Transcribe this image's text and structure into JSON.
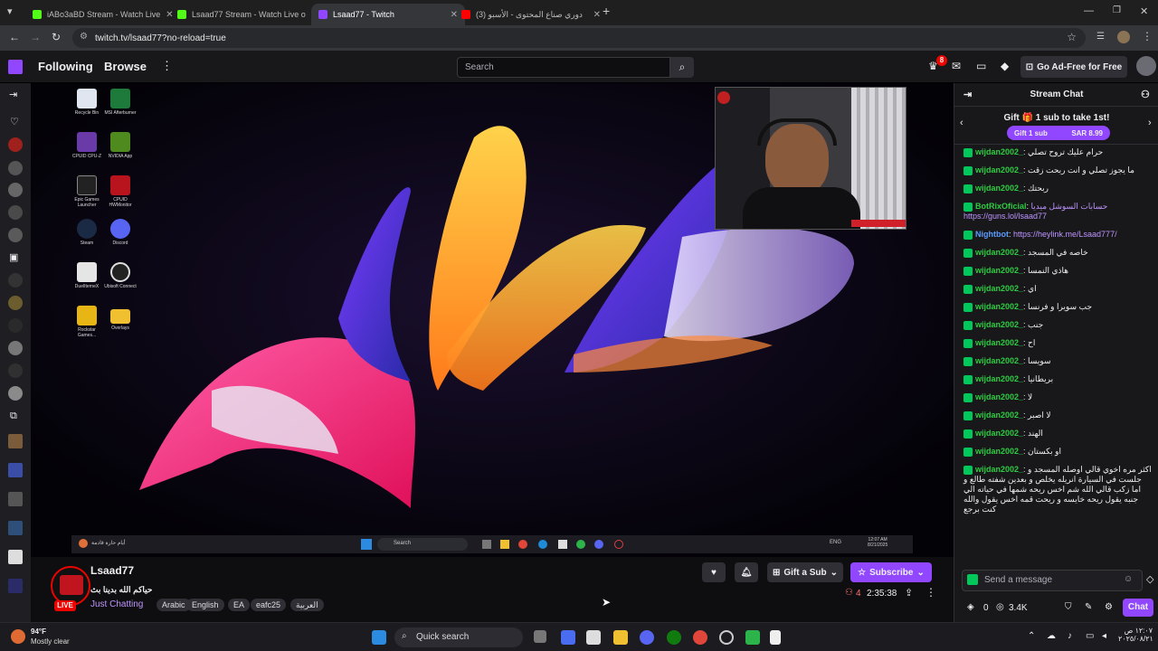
{
  "browser": {
    "tabs": [
      {
        "title": "iABo3aBD Stream - Watch Live",
        "active": false
      },
      {
        "title": "Lsaad77 Stream - Watch Live o",
        "active": false
      },
      {
        "title": "Lsaad77 - Twitch",
        "active": true
      },
      {
        "title": "(3) دوري صناع المحتوى - الأسبو",
        "active": false
      }
    ],
    "url": "twitch.tv/lsaad77?no-reload=true"
  },
  "nav": {
    "following": "Following",
    "browse": "Browse",
    "search_placeholder": "Search",
    "notification_count": "8",
    "ad_free": "Go Ad-Free for Free"
  },
  "stream": {
    "desktop_icons": [
      {
        "label": "Recycle Bin",
        "color": "#dfe6f0"
      },
      {
        "label": "MSI Afterburner",
        "color": "#1e7a3a"
      },
      {
        "label": "CPUID CPU-Z",
        "color": "#6a3aa8"
      },
      {
        "label": "NVIDIA App",
        "color": "#4f8a1e"
      },
      {
        "label": "Epic Games Launcher",
        "color": "#222"
      },
      {
        "label": "CPUID HWMonitor",
        "color": "#b8141e"
      },
      {
        "label": "Steam",
        "color": "#1b2a44"
      },
      {
        "label": "Discord",
        "color": "#5865f2"
      },
      {
        "label": "DuelIterneX",
        "color": "#e5e5e5"
      },
      {
        "label": "Ubisoft Connect",
        "color": "#222"
      },
      {
        "label": "Rockstar Games...",
        "color": "#e7b614"
      },
      {
        "label": "Overlays",
        "color": "#f0c030"
      }
    ],
    "inner_taskbar": {
      "weather": "أيام حارة قادمة",
      "search": "Search",
      "lang": "ENG",
      "time": "12:07 AM",
      "date": "8/21/2025"
    }
  },
  "channel": {
    "name": "Lsaad77",
    "title": "حياكم الله بدينا بث",
    "category": "Just Chatting",
    "tags": [
      "Arabic",
      "English",
      "EA",
      "eafc25",
      "العربية"
    ],
    "live_label": "LIVE",
    "gift_sub": "Gift a Sub",
    "subscribe": "Subscribe",
    "viewers": "4",
    "uptime": "2:35:38"
  },
  "chat": {
    "header": "Stream Chat",
    "gift_prompt": "Gift 🎁 1 sub to take 1st!",
    "gift_button": "Gift 1 sub",
    "gift_price": "SAR 8.99",
    "messages": [
      {
        "user": "wijdan2002_",
        "text": "حرام عليك تروح تصلي",
        "kind": "normal"
      },
      {
        "user": "wijdan2002_",
        "text": "ما يجوز تصلي و انت ربحت زقت",
        "kind": "normal"
      },
      {
        "user": "wijdan2002_",
        "text": "ربحتك",
        "kind": "normal"
      },
      {
        "user": "BotRixOficial",
        "text": "حسابات السوشل ميديا https://guns.lol/lsaad77",
        "kind": "bot"
      },
      {
        "user": "Nightbot",
        "text": "https://heylink.me/Lsaad777/",
        "kind": "nightbot"
      },
      {
        "user": "wijdan2002_",
        "text": "خاصه في المسجد",
        "kind": "normal"
      },
      {
        "user": "wijdan2002_",
        "text": "هاذي النمسا",
        "kind": "normal"
      },
      {
        "user": "wijdan2002_",
        "text": "اي",
        "kind": "normal"
      },
      {
        "user": "wijdan2002_",
        "text": "جب سويرا و فرنسا",
        "kind": "normal"
      },
      {
        "user": "wijdan2002_",
        "text": "جنب",
        "kind": "normal"
      },
      {
        "user": "wijdan2002_",
        "text": "اح",
        "kind": "normal"
      },
      {
        "user": "wijdan2002_",
        "text": "سويسا",
        "kind": "normal"
      },
      {
        "user": "wijdan2002_",
        "text": "بريطانيا",
        "kind": "normal"
      },
      {
        "user": "wijdan2002_",
        "text": "لا",
        "kind": "normal"
      },
      {
        "user": "wijdan2002_",
        "text": "لا اصبر",
        "kind": "normal"
      },
      {
        "user": "wijdan2002_",
        "text": "الهند",
        "kind": "normal"
      },
      {
        "user": "wijdan2002_",
        "text": "او بكستان",
        "kind": "normal"
      },
      {
        "user": "wijdan2002_",
        "text": "اكثر مره اخوي قالي اوصله المسجد و جلست في السيارة انريله يخلص و بعدين شفته طالع و اما زكب قالي الله شم اخس ريحه شمها في حياته الي جنبه يقول ريحه خايسه و ريحت قمه اخس يقول والله كنت برجع",
        "kind": "normal"
      }
    ],
    "input_placeholder": "Send a message",
    "points_a": "0",
    "points_b": "3.4K",
    "chat_button": "Chat"
  },
  "os_taskbar": {
    "weather_temp": "94°F",
    "weather_desc": "Mostly clear",
    "search": "Quick search",
    "time": "١٢:٠٧ ص",
    "date": "٢٠٢٥/٠٨/٢١"
  }
}
